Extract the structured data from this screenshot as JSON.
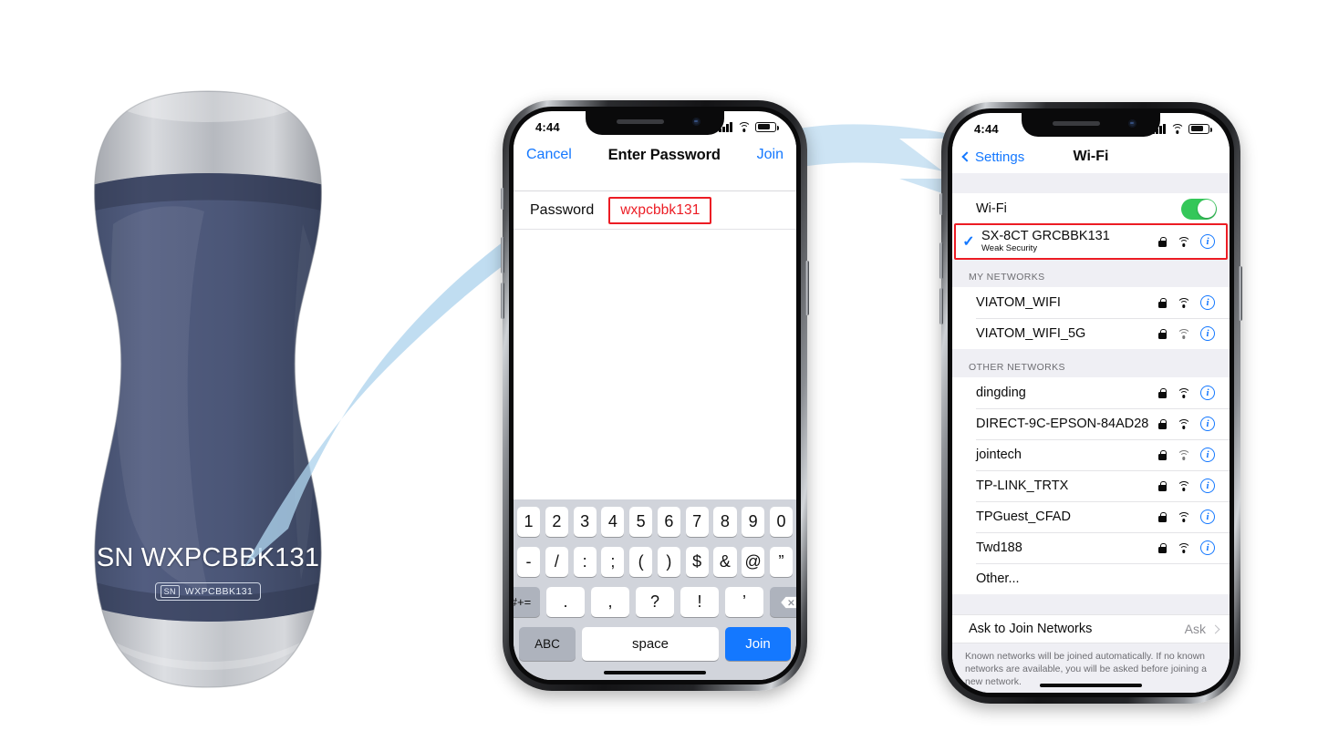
{
  "device": {
    "serial_display": "SN WXPCBBK131",
    "label_tag": "SN",
    "label_serial": "WXPCBBK131",
    "body_color": "#4a5578",
    "cap_color": "#b9bcc2"
  },
  "arrows": {
    "color": "#b9d9ef",
    "arrow1_name": "probe-to-password-arrow",
    "arrow2_name": "wifi-list-to-password-arrow"
  },
  "phone_password": {
    "statusbar": {
      "time": "4:44",
      "signal": "signal-bars",
      "wifi": "wifi-icon",
      "battery": "battery-icon"
    },
    "navbar": {
      "cancel": "Cancel",
      "title": "Enter Password",
      "join": "Join"
    },
    "form": {
      "label": "Password",
      "value": "wxpcbbk131",
      "highlight_color": "#ec1c24"
    },
    "keyboard": {
      "row1": [
        "1",
        "2",
        "3",
        "4",
        "5",
        "6",
        "7",
        "8",
        "9",
        "0"
      ],
      "row2": [
        "-",
        "/",
        ":",
        ";",
        "(",
        ")",
        "$",
        "&",
        "@",
        "”"
      ],
      "row3_fn": "#+=",
      "row3": [
        ".",
        ",",
        "?",
        "!",
        "’"
      ],
      "row3_del": "delete-key",
      "abc": "ABC",
      "space": "space",
      "join": "Join"
    }
  },
  "phone_wifi": {
    "statusbar": {
      "time": "4:44"
    },
    "navbar": {
      "back": "Settings",
      "title": "Wi-Fi"
    },
    "toggle_row": {
      "label": "Wi-Fi",
      "enabled": true,
      "on_color": "#34c759"
    },
    "selected_network": {
      "ssid": "SX-8CT GRCBBK131",
      "subtitle": "Weak Security",
      "checked": true,
      "highlight_color": "#ec1c24"
    },
    "sections": [
      {
        "header": "MY NETWORKS",
        "networks": [
          {
            "ssid": "VIATOM_WIFI",
            "locked": true,
            "signal": 3
          },
          {
            "ssid": "VIATOM_WIFI_5G",
            "locked": true,
            "signal": 2
          }
        ]
      },
      {
        "header": "OTHER NETWORKS",
        "networks": [
          {
            "ssid": "dingding",
            "locked": true,
            "signal": 3
          },
          {
            "ssid": "DIRECT-9C-EPSON-84AD28",
            "locked": true,
            "signal": 3
          },
          {
            "ssid": "jointech",
            "locked": true,
            "signal": 2
          },
          {
            "ssid": "TP-LINK_TRTX",
            "locked": true,
            "signal": 3
          },
          {
            "ssid": "TPGuest_CFAD",
            "locked": true,
            "signal": 3
          },
          {
            "ssid": "Twd188",
            "locked": true,
            "signal": 3
          }
        ],
        "other_label": "Other..."
      }
    ],
    "ask_to_join": {
      "label": "Ask to Join Networks",
      "value": "Ask"
    },
    "footer": "Known networks will be joined automatically. If no known networks are available, you will be asked before joining a new network."
  }
}
